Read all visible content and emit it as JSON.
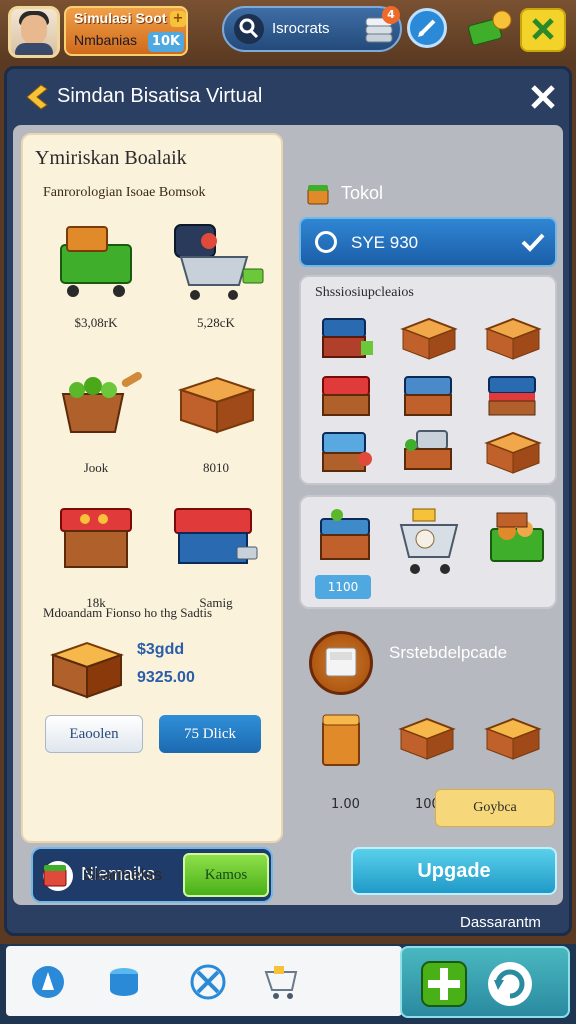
{
  "player": {
    "name": "Simulasi Soot",
    "subtitle": "Nmbanias",
    "level": "10K"
  },
  "topbar": {
    "search_label": "Isrocrats",
    "notifications": "4"
  },
  "panel": {
    "title": "Simdan Bisatisa Virtual"
  },
  "left_card": {
    "title": "Ymiriskan Boalaik",
    "subtitle": "Fanrorologian Isoae Bomsok",
    "items": [
      {
        "label": "$3,08rK",
        "icon": "crate-cart-icon"
      },
      {
        "label": "5,28cK",
        "icon": "shopping-cart-icon"
      },
      {
        "label": "Jook",
        "icon": "produce-basket-icon"
      },
      {
        "label": "8010",
        "icon": "wooden-crate-icon"
      },
      {
        "label": "18k",
        "icon": "market-stall-icon"
      },
      {
        "label": "Samig",
        "icon": "stall-cart-icon"
      }
    ],
    "mid_heading": "Mdoandam Fionso ho thg Sadtis",
    "featured_price_1": "$3gdd",
    "featured_price_2": "9325.00",
    "cancel_label": "Eaoolen",
    "buy_label": "75 Dlick"
  },
  "bottom_left": {
    "text": "Nlemaiks",
    "button_label": "Kamos"
  },
  "right": {
    "tokol_label": "Tokol",
    "tokol_value": "SYE 930",
    "upgrades_title": "Shssiosiupcleaios",
    "cart_price": "1100",
    "storage_label": "Srstebdelpcade",
    "slot_price_1": "1.00",
    "slot_price_2": "100",
    "slot_button": "Goybca"
  },
  "footer": {
    "stock_label": "Skarinelas",
    "upgrade_label": "Upgade",
    "hint": "Dassarantm"
  },
  "colors": {
    "panel_bg": "#2b3f63",
    "accent_blue": "#2f86d4",
    "accent_green": "#4ab018",
    "gold": "#f3d22a"
  }
}
